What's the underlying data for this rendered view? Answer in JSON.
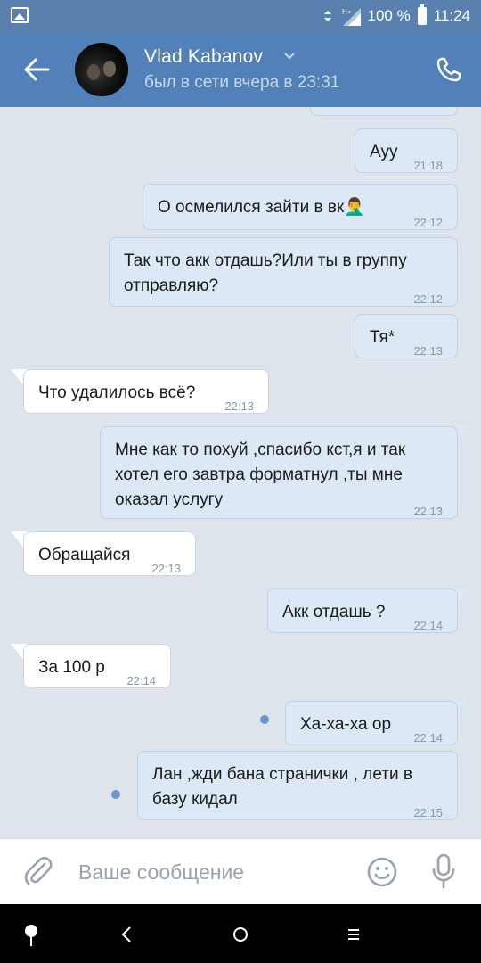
{
  "status_bar": {
    "network": "H+",
    "battery": "100 %",
    "time": "11:24"
  },
  "header": {
    "name": "Vlad Kabanov",
    "status": "был в сети вчера в 23:31"
  },
  "messages": [
    {
      "dir": "out",
      "text": "Ауу",
      "time": "21:18"
    },
    {
      "dir": "out",
      "text": "О осмелился зайти в вк🤦‍♂️",
      "time": "22:12"
    },
    {
      "dir": "out",
      "text": "Так что акк отдашь?Или ты в группу отправляю?",
      "time": "22:12"
    },
    {
      "dir": "out",
      "text": "Тя*",
      "time": "22:13"
    },
    {
      "dir": "in",
      "text": "Что удалилось всё?",
      "time": "22:13"
    },
    {
      "dir": "out",
      "text": "Мне как то похуй ,спасибо кст,я и так хотел его завтра форматнул ,ты мне оказал услугу",
      "time": "22:13"
    },
    {
      "dir": "in",
      "text": "Обращайся",
      "time": "22:13"
    },
    {
      "dir": "out",
      "text": "Акк отдашь ?",
      "time": "22:14"
    },
    {
      "dir": "in",
      "text": "За 100 р",
      "time": "22:14"
    },
    {
      "dir": "out",
      "text": "Ха-ха-ха ор",
      "time": "22:14",
      "unread": true
    },
    {
      "dir": "out",
      "text": "Лан ,жди бана странички , лети в базу кидал",
      "time": "22:15",
      "unread": true
    }
  ],
  "input": {
    "placeholder": "Ваше сообщение"
  },
  "colors": {
    "header": "#5181b8",
    "outgoing_bubble": "#dce8f6",
    "incoming_bubble": "#ffffff",
    "chat_bg": "#dee4ec"
  }
}
